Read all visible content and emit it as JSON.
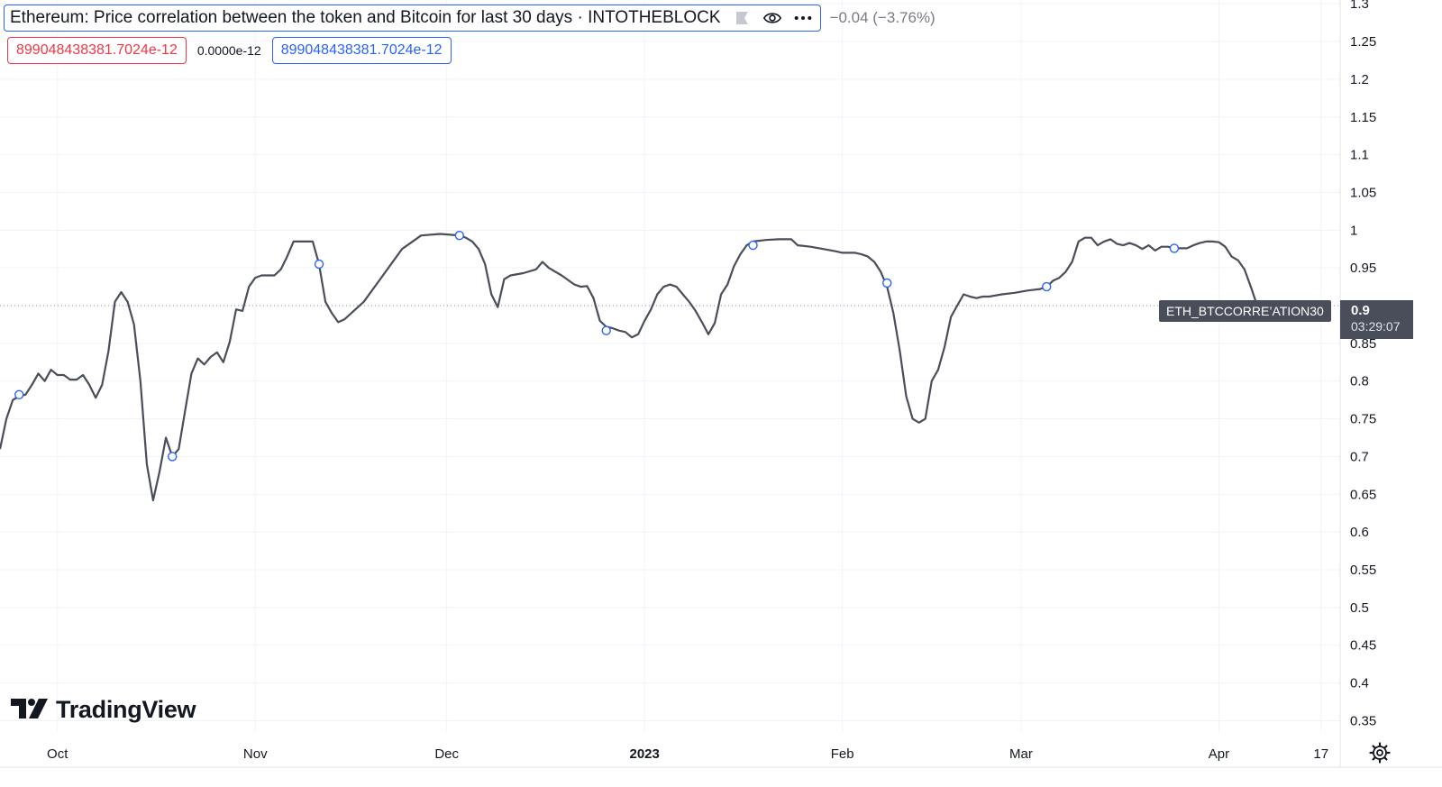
{
  "header": {
    "title": "Ethereum: Price correlation between the token and Bitcoin for last 30 days · INTOTHEBLOCK",
    "change": "−0.04 (−3.76%)",
    "icons": [
      "flag-icon",
      "eye-icon",
      "more-icon"
    ]
  },
  "values": {
    "open": "899048438381.7024e-12",
    "mid": "0.0000e-12",
    "close": "899048438381.7024e-12"
  },
  "logo": {
    "text": "TradingView"
  },
  "price_label": {
    "series": "ETH_BTCCORRE’ATION30",
    "value": "0.9",
    "countdown": "03:29:07"
  },
  "colors": {
    "line": "#4a4e5a",
    "marker": "#2962ff",
    "grid": "#f0f3fa",
    "red": "#f23645",
    "blue": "#2962ff"
  },
  "chart_data": {
    "type": "line",
    "series": [
      {
        "points": [
          [
            "2022-09-22",
            0.71
          ],
          [
            "2022-09-23",
            0.75
          ],
          [
            "2022-09-24",
            0.775
          ],
          [
            "2022-09-25",
            0.78
          ],
          [
            "2022-09-26",
            0.782
          ],
          [
            "2022-09-27",
            0.795
          ],
          [
            "2022-09-28",
            0.81
          ],
          [
            "2022-09-29",
            0.8
          ],
          [
            "2022-09-30",
            0.815
          ],
          [
            "2022-10-01",
            0.808
          ],
          [
            "2022-10-02",
            0.808
          ],
          [
            "2022-10-03",
            0.802
          ],
          [
            "2022-10-04",
            0.802
          ],
          [
            "2022-10-05",
            0.808
          ],
          [
            "2022-10-06",
            0.795
          ],
          [
            "2022-10-07",
            0.778
          ],
          [
            "2022-10-08",
            0.795
          ],
          [
            "2022-10-09",
            0.84
          ],
          [
            "2022-10-10",
            0.905
          ],
          [
            "2022-10-11",
            0.918
          ],
          [
            "2022-10-12",
            0.905
          ],
          [
            "2022-10-13",
            0.875
          ],
          [
            "2022-10-14",
            0.8
          ],
          [
            "2022-10-15",
            0.69
          ],
          [
            "2022-10-16",
            0.642
          ],
          [
            "2022-10-17",
            0.68
          ],
          [
            "2022-10-18",
            0.725
          ],
          [
            "2022-10-19",
            0.7
          ],
          [
            "2022-10-20",
            0.71
          ],
          [
            "2022-10-21",
            0.76
          ],
          [
            "2022-10-22",
            0.81
          ],
          [
            "2022-10-23",
            0.83
          ],
          [
            "2022-10-24",
            0.822
          ],
          [
            "2022-10-25",
            0.832
          ],
          [
            "2022-10-26",
            0.838
          ],
          [
            "2022-10-27",
            0.825
          ],
          [
            "2022-10-28",
            0.852
          ],
          [
            "2022-10-29",
            0.895
          ],
          [
            "2022-10-30",
            0.893
          ],
          [
            "2022-10-31",
            0.925
          ],
          [
            "2022-11-01",
            0.937
          ],
          [
            "2022-11-02",
            0.94
          ],
          [
            "2022-11-03",
            0.94
          ],
          [
            "2022-11-04",
            0.94
          ],
          [
            "2022-11-05",
            0.948
          ],
          [
            "2022-11-06",
            0.965
          ],
          [
            "2022-11-07",
            0.985
          ],
          [
            "2022-11-08",
            0.985
          ],
          [
            "2022-11-09",
            0.985
          ],
          [
            "2022-11-10",
            0.985
          ],
          [
            "2022-11-11",
            0.955
          ],
          [
            "2022-11-12",
            0.905
          ],
          [
            "2022-11-13",
            0.89
          ],
          [
            "2022-11-14",
            0.878
          ],
          [
            "2022-11-15",
            0.882
          ],
          [
            "2022-11-18",
            0.905
          ],
          [
            "2022-11-21",
            0.94
          ],
          [
            "2022-11-24",
            0.975
          ],
          [
            "2022-11-27",
            0.993
          ],
          [
            "2022-11-30",
            0.995
          ],
          [
            "2022-12-03",
            0.993
          ],
          [
            "2022-12-04",
            0.99
          ],
          [
            "2022-12-05",
            0.985
          ],
          [
            "2022-12-06",
            0.975
          ],
          [
            "2022-12-07",
            0.955
          ],
          [
            "2022-12-08",
            0.915
          ],
          [
            "2022-12-09",
            0.898
          ],
          [
            "2022-12-10",
            0.935
          ],
          [
            "2022-12-11",
            0.94
          ],
          [
            "2022-12-13",
            0.943
          ],
          [
            "2022-12-15",
            0.948
          ],
          [
            "2022-12-16",
            0.958
          ],
          [
            "2022-12-17",
            0.95
          ],
          [
            "2022-12-19",
            0.94
          ],
          [
            "2022-12-21",
            0.928
          ],
          [
            "2022-12-22",
            0.925
          ],
          [
            "2022-12-23",
            0.926
          ],
          [
            "2022-12-24",
            0.91
          ],
          [
            "2022-12-25",
            0.88
          ],
          [
            "2022-12-26",
            0.872
          ],
          [
            "2022-12-27",
            0.87
          ],
          [
            "2022-12-28",
            0.867
          ],
          [
            "2022-12-29",
            0.865
          ],
          [
            "2022-12-30",
            0.858
          ],
          [
            "2022-12-31",
            0.862
          ],
          [
            "2023-01-01",
            0.88
          ],
          [
            "2023-01-02",
            0.895
          ],
          [
            "2023-01-03",
            0.915
          ],
          [
            "2023-01-04",
            0.925
          ],
          [
            "2023-01-05",
            0.928
          ],
          [
            "2023-01-06",
            0.925
          ],
          [
            "2023-01-07",
            0.915
          ],
          [
            "2023-01-08",
            0.905
          ],
          [
            "2023-01-09",
            0.893
          ],
          [
            "2023-01-10",
            0.878
          ],
          [
            "2023-01-11",
            0.862
          ],
          [
            "2023-01-12",
            0.877
          ],
          [
            "2023-01-13",
            0.915
          ],
          [
            "2023-01-14",
            0.928
          ],
          [
            "2023-01-15",
            0.952
          ],
          [
            "2023-01-16",
            0.968
          ],
          [
            "2023-01-17",
            0.98
          ],
          [
            "2023-01-18",
            0.985
          ],
          [
            "2023-01-20",
            0.987
          ],
          [
            "2023-01-22",
            0.988
          ],
          [
            "2023-01-24",
            0.988
          ],
          [
            "2023-01-25",
            0.98
          ],
          [
            "2023-01-27",
            0.978
          ],
          [
            "2023-01-29",
            0.975
          ],
          [
            "2023-01-31",
            0.972
          ],
          [
            "2023-02-01",
            0.97
          ],
          [
            "2023-02-02",
            0.97
          ],
          [
            "2023-02-03",
            0.97
          ],
          [
            "2023-02-04",
            0.968
          ],
          [
            "2023-02-05",
            0.965
          ],
          [
            "2023-02-06",
            0.958
          ],
          [
            "2023-02-07",
            0.945
          ],
          [
            "2023-02-08",
            0.925
          ],
          [
            "2023-02-09",
            0.89
          ],
          [
            "2023-02-10",
            0.84
          ],
          [
            "2023-02-11",
            0.78
          ],
          [
            "2023-02-12",
            0.75
          ],
          [
            "2023-02-13",
            0.745
          ],
          [
            "2023-02-14",
            0.75
          ],
          [
            "2023-02-15",
            0.8
          ],
          [
            "2023-02-16",
            0.815
          ],
          [
            "2023-02-17",
            0.845
          ],
          [
            "2023-02-18",
            0.885
          ],
          [
            "2023-02-19",
            0.9
          ],
          [
            "2023-02-20",
            0.915
          ],
          [
            "2023-02-21",
            0.912
          ],
          [
            "2023-02-22",
            0.91
          ],
          [
            "2023-02-23",
            0.912
          ],
          [
            "2023-02-24",
            0.912
          ],
          [
            "2023-02-26",
            0.915
          ],
          [
            "2023-02-28",
            0.917
          ],
          [
            "2023-03-02",
            0.92
          ],
          [
            "2023-03-04",
            0.922
          ],
          [
            "2023-03-05",
            0.925
          ],
          [
            "2023-03-06",
            0.933
          ],
          [
            "2023-03-07",
            0.937
          ],
          [
            "2023-03-08",
            0.945
          ],
          [
            "2023-03-09",
            0.958
          ],
          [
            "2023-03-10",
            0.985
          ],
          [
            "2023-03-11",
            0.99
          ],
          [
            "2023-03-12",
            0.99
          ],
          [
            "2023-03-13",
            0.98
          ],
          [
            "2023-03-14",
            0.985
          ],
          [
            "2023-03-15",
            0.988
          ],
          [
            "2023-03-16",
            0.982
          ],
          [
            "2023-03-17",
            0.98
          ],
          [
            "2023-03-18",
            0.983
          ],
          [
            "2023-03-19",
            0.98
          ],
          [
            "2023-03-20",
            0.975
          ],
          [
            "2023-03-21",
            0.98
          ],
          [
            "2023-03-22",
            0.973
          ],
          [
            "2023-03-23",
            0.978
          ],
          [
            "2023-03-24",
            0.978
          ],
          [
            "2023-03-25",
            0.976
          ],
          [
            "2023-03-26",
            0.976
          ],
          [
            "2023-03-27",
            0.976
          ],
          [
            "2023-03-28",
            0.98
          ],
          [
            "2023-03-29",
            0.983
          ],
          [
            "2023-03-30",
            0.985
          ],
          [
            "2023-03-31",
            0.985
          ],
          [
            "2023-04-01",
            0.984
          ],
          [
            "2023-04-02",
            0.978
          ],
          [
            "2023-04-03",
            0.965
          ],
          [
            "2023-04-04",
            0.96
          ],
          [
            "2023-04-05",
            0.948
          ],
          [
            "2023-04-06",
            0.925
          ],
          [
            "2023-04-07",
            0.9
          ]
        ],
        "markers": [
          [
            "2022-09-25",
            0.782
          ],
          [
            "2022-10-19",
            0.7
          ],
          [
            "2022-11-11",
            0.955
          ],
          [
            "2022-12-03",
            0.993
          ],
          [
            "2022-12-26",
            0.867
          ],
          [
            "2023-01-18",
            0.98
          ],
          [
            "2023-02-08",
            0.93
          ],
          [
            "2023-03-05",
            0.925
          ],
          [
            "2023-03-25",
            0.976
          ]
        ]
      }
    ],
    "xlim": [
      "2022-09-22",
      "2023-04-20"
    ],
    "ylim": [
      0.335,
      1.305
    ],
    "yticks": [
      1.3,
      1.25,
      1.2,
      1.15,
      1.1,
      1.05,
      1,
      0.95,
      0.9,
      0.85,
      0.8,
      0.75,
      0.7,
      0.65,
      0.6,
      0.55,
      0.5,
      0.45,
      0.4,
      0.35
    ],
    "xticks": [
      {
        "date": "2022-10-01",
        "label": "Oct",
        "bold": false
      },
      {
        "date": "2022-11-01",
        "label": "Nov",
        "bold": false
      },
      {
        "date": "2022-12-01",
        "label": "Dec",
        "bold": false
      },
      {
        "date": "2023-01-01",
        "label": "2023",
        "bold": true
      },
      {
        "date": "2023-02-01",
        "label": "Feb",
        "bold": false
      },
      {
        "date": "2023-03-01",
        "label": "Mar",
        "bold": false
      },
      {
        "date": "2023-04-01",
        "label": "Apr",
        "bold": false
      },
      {
        "date": "2023-04-17",
        "label": "17",
        "bold": false
      }
    ],
    "last_value": 0.9,
    "grid": true
  }
}
